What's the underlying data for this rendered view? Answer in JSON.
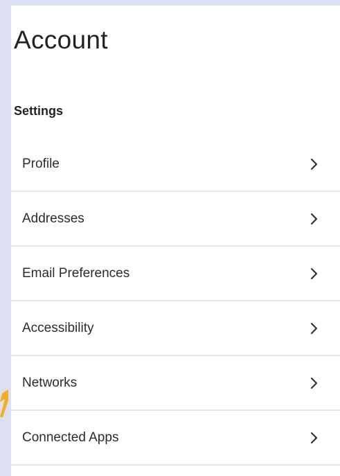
{
  "page": {
    "title": "Account",
    "section_heading": "Settings"
  },
  "settings": {
    "items": [
      {
        "label": "Profile",
        "icon": "chevron-right-icon"
      },
      {
        "label": "Addresses",
        "icon": "chevron-right-icon"
      },
      {
        "label": "Email Preferences",
        "icon": "chevron-right-icon"
      },
      {
        "label": "Accessibility",
        "icon": "chevron-right-icon"
      },
      {
        "label": "Networks",
        "icon": "chevron-right-icon"
      },
      {
        "label": "Connected Apps",
        "icon": "chevron-right-icon"
      }
    ]
  },
  "colors": {
    "background": "#dcdfef",
    "panel": "#ffffff",
    "text": "#222222",
    "divider": "#e6e6e6",
    "accent": "#f2b01e"
  }
}
